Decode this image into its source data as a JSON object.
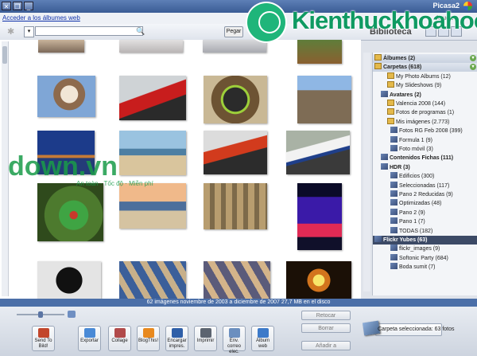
{
  "window": {
    "title": "Picasa2",
    "buttons": {
      "close": "✕",
      "maximize": "❐",
      "minimize": "_"
    }
  },
  "menubar": {
    "web_link": "Acceder a los álbumes web",
    "right_label": "Ayuda"
  },
  "toolbar": {
    "search_placeholder": "",
    "search_icon": "search-icon",
    "sort_label": "▾",
    "paste_label": "Pegar",
    "library_title": "Biblioteca"
  },
  "status": {
    "text": "62 imágenes     noviembre de 2003 a diciembre de 2007   27,7 MB en el disco"
  },
  "sidebar": {
    "items": [
      {
        "label": "Álbumes (2)",
        "kind": "hdr"
      },
      {
        "label": "Carpetas (618)",
        "kind": "hdr"
      },
      {
        "label": "My Photo Albums (12)",
        "kind": "folder"
      },
      {
        "label": "My Slideshows (9)",
        "kind": "folder"
      },
      {
        "label": "Avatares (2)",
        "kind": "sec"
      },
      {
        "label": "Valencia 2008 (144)",
        "kind": "folder"
      },
      {
        "label": "Fotos de programas (1)",
        "kind": "folder"
      },
      {
        "label": "Mis imágenes (2.773)",
        "kind": "folder"
      },
      {
        "label": "Fotos RG Feb 2008 (399)",
        "kind": "pic"
      },
      {
        "label": "Formula 1 (9)",
        "kind": "pic"
      },
      {
        "label": "Foto móvil (3)",
        "kind": "pic"
      },
      {
        "label": "Contenidos Fichas (111)",
        "kind": "sec"
      },
      {
        "label": "HDR (3)",
        "kind": "sec"
      },
      {
        "label": "Edificios (300)",
        "kind": "pic"
      },
      {
        "label": "Seleccionadas (117)",
        "kind": "pic"
      },
      {
        "label": "Pano 2 Reducidas (9)",
        "kind": "pic"
      },
      {
        "label": "Optimizadas (48)",
        "kind": "pic"
      },
      {
        "label": "Pano 2 (9)",
        "kind": "pic"
      },
      {
        "label": "Pano 1 (7)",
        "kind": "pic"
      },
      {
        "label": "TODAS (182)",
        "kind": "pic"
      },
      {
        "label": "Flickr Yubes (63)",
        "kind": "sel"
      },
      {
        "label": "flickr_images (9)",
        "kind": "pic"
      },
      {
        "label": "Softonic Party (684)",
        "kind": "pic"
      },
      {
        "label": "Boda sumit (7)",
        "kind": "pic"
      }
    ]
  },
  "bottom": {
    "side_buttons": [
      "Retocar",
      "Borrar",
      "Añadir a"
    ],
    "tray_caption": "Carpeta seleccionada: 63 fotos",
    "tools": [
      {
        "label": "Álbum web",
        "color": "#3d7ac9"
      },
      {
        "label": "Env. correo elec.",
        "color": "#6b8fbf"
      },
      {
        "label": "Imprimir",
        "color": "#5c6470"
      },
      {
        "label": "Encargar impres.",
        "color": "#2f5fa8"
      },
      {
        "label": "BlogThis!",
        "color": "#e8891e"
      },
      {
        "label": "Collage",
        "color": "#b14a4a"
      },
      {
        "label": "Exportar",
        "color": "#4a8ad6"
      },
      {
        "label": "Send To Bild!",
        "color": "#c2462b"
      }
    ]
  },
  "watermark": {
    "top_brand": "Kienthuckhoahoc",
    "bottom_brand": "down.vn",
    "bottom_tag": "An toàn · Tốc độ · Miễn phí"
  }
}
